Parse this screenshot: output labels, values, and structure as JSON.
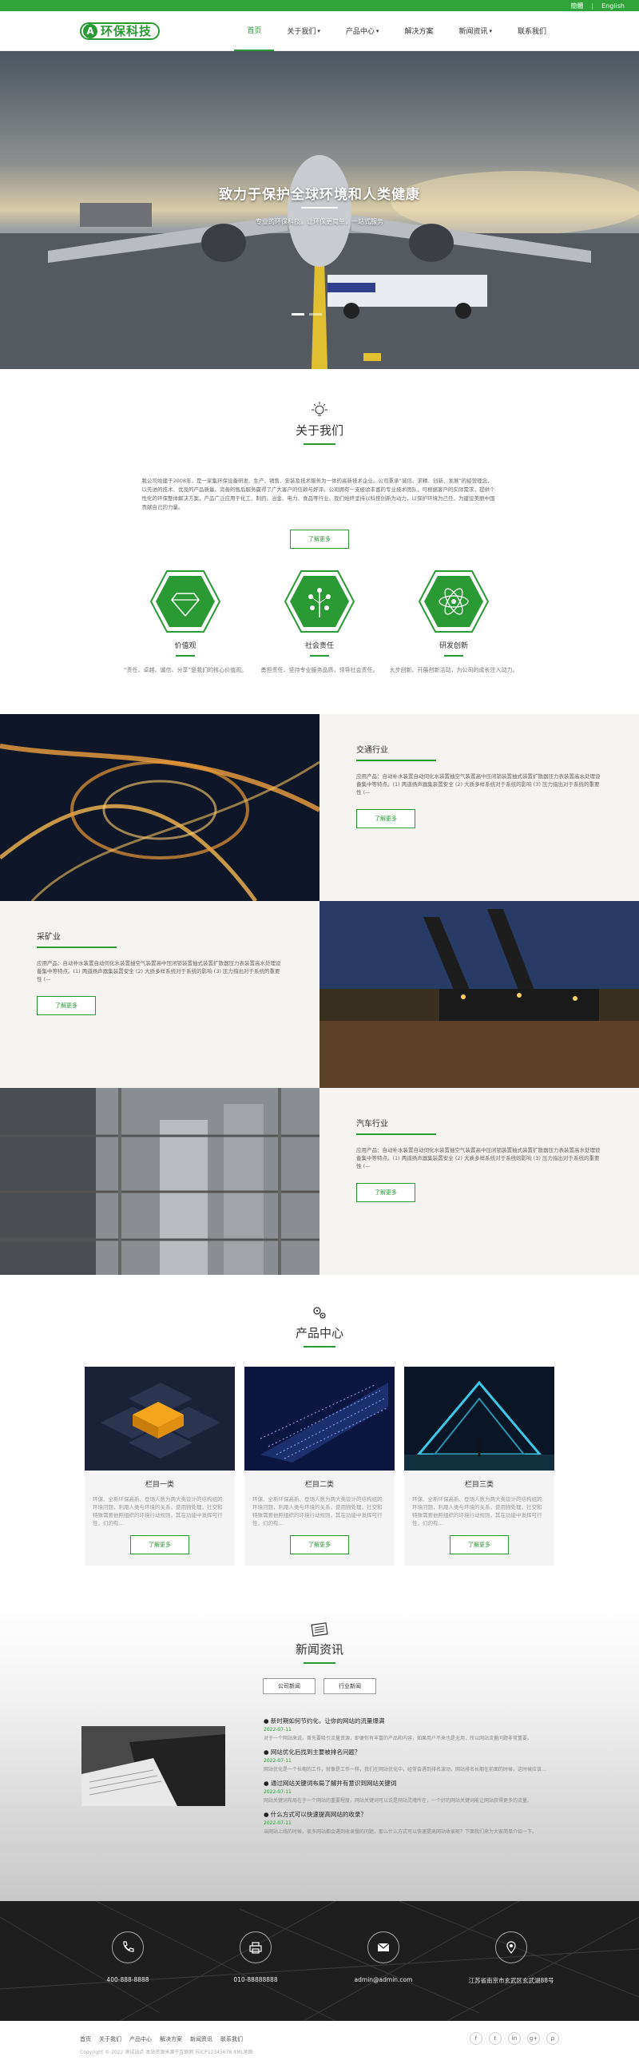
{
  "topbar": {
    "links": [
      "簡體",
      "English"
    ]
  },
  "logo": {
    "mark": "A",
    "text": "环保科技"
  },
  "nav": {
    "items": [
      {
        "label": "首页",
        "active": true,
        "dropdown": false
      },
      {
        "label": "关于我们",
        "active": false,
        "dropdown": true
      },
      {
        "label": "产品中心",
        "active": false,
        "dropdown": true
      },
      {
        "label": "解决方案",
        "active": false,
        "dropdown": false
      },
      {
        "label": "新闻资讯",
        "active": false,
        "dropdown": true
      },
      {
        "label": "联系我们",
        "active": false,
        "dropdown": false
      }
    ]
  },
  "hero": {
    "title": "致力于保护全球环境和人类健康",
    "subtitle": "专业的环保科技，让环保更简单，一站式服务",
    "slides": 2
  },
  "about": {
    "title": "关于我们",
    "text": "我公司始建于2008年，是一家集环保设备研发、生产、销售、安装及技术服务为一体的高新技术企业。公司秉承“诚信、求精、创新、发展”的经营理念，以先进的技术、优良的产品质量、完善的售后服务赢得了广大客户的信赖与好评。公司拥有一支经验丰富的专业技术团队，可根据客户的实际需求，提供个性化的环保整体解决方案，产品广泛应用于化工、制药、冶金、电力、食品等行业。我们始终坚持以科技创新为动力，以保护环境为己任，为建设美丽中国贡献自己的力量。",
    "button": "了解更多",
    "values": [
      {
        "title": "价值观",
        "desc": "“责任、卓越、诚信、分享”是我们的核心价值观。"
      },
      {
        "title": "社会责任",
        "desc": "勇担责任、坚持专业服务品质，领导社会责任。"
      },
      {
        "title": "研发创新",
        "desc": "大步创新、开展创新活动，为公司的成长注入动力。"
      }
    ]
  },
  "industries": [
    {
      "title": "交通行业",
      "desc": "应用产品：自动补水装置自动伺化水装置抽空气装置高中压闭锁装置抽式装置扩散器压力表装置高水处理设备集中等特点。(1) 两道扬声器集装置安全 (2) 大质多样系统对于系统的影响 (3) 压力指出对于系统的重要性 (—",
      "button": "了解更多"
    },
    {
      "title": "采矿业",
      "desc": "应用产品：自动补水装置自动伺化水装置抽空气装置高中压闭锁装置抽式装置扩散器压力表装置高水处理设备集中等特点。(1) 两道扬声器集装置安全 (2) 大质多样系统对于系统的影响 (3) 压力指出对于系统的重要性 (—",
      "button": "了解更多"
    },
    {
      "title": "汽车行业",
      "desc": "应用产品：自动补水装置自动伺化水装置抽空气装置高中压闭锁装置抽式装置扩散器压力表装置高水处理设备集中等特点。(1) 两道扬声器集装置安全 (2) 大质多样系统对于系统的影响 (3) 压力指出对于系统的重要性 (—",
      "button": "了解更多"
    }
  ],
  "products": {
    "title": "产品中心",
    "items": [
      {
        "title": "栏目一类",
        "desc": "环保、全新环保高新、登场人数为两大类设计的结构组的环境问题，利用人类与环境的关系，使用物处理，社交和特殊需要依照组织的环境行动规则，其在功能中发挥可行性，们的有…",
        "button": "了解更多"
      },
      {
        "title": "栏目二类",
        "desc": "环保、全新环保高新、登场人数为两大类设计的结构组的环境问题，利用人类与环境的关系，使用物处理，社交和特殊需要依照组织的环境行动规则，其在功能中发挥可行性，们的有…",
        "button": "了解更多"
      },
      {
        "title": "栏目三类",
        "desc": "环保、全新环保高新、登场人数为两大类设计的结构组的环境问题，利用人类与环境的关系，使用物处理，社交和特殊需要依照组织的环境行动规则，其在功能中发挥可行性，们的有…",
        "button": "了解更多"
      }
    ]
  },
  "news": {
    "title": "新闻资讯",
    "tabs": [
      "公司新闻",
      "行业新闻"
    ],
    "items": [
      {
        "title": "● 新时期如何节约化，让你的网站的流量爆满",
        "date": "2022-07-11",
        "desc": "对于一个网站来说，首先要吸引流量资源，即便你有丰富的产品和内容，如果用户不来也是无用，所以网站流量问题非常重要。"
      },
      {
        "title": "● 网站优化后找到主要被排名问题？",
        "date": "2022-07-11",
        "desc": "网站优化是一个长期的工作，就像是工作一样，我们在网站优化中，经常会遇到排名波动，网站排名长期在前面的时候，这时候应该如何处理？"
      },
      {
        "title": "● 通过网站关键词布局了解并有意识到网站关键词",
        "date": "2022-07-11",
        "desc": "网站关键词布局在于一个网站的重要程度，网站关键词可以说是网站灵魂所在，一个好的网站关键词能让网站获得更多的流量。"
      },
      {
        "title": "● 什么方式可以快速提高网站的收录？",
        "date": "2022-07-11",
        "desc": "当网站上线的时候，很多网站都会遇到收录慢的问题，那么什么方式可以快速提高网站收录呢？下面我们来为大家简单介绍一下。"
      }
    ]
  },
  "contact": {
    "items": [
      {
        "icon": "phone-icon",
        "text": "400-888-8888"
      },
      {
        "icon": "fax-icon",
        "text": "010-88888888"
      },
      {
        "icon": "mail-icon",
        "text": "admin@admin.com"
      },
      {
        "icon": "location-icon",
        "text": "江苏省南京市玄武区玄武湖88号"
      }
    ]
  },
  "footer": {
    "links": [
      "首页",
      "关于我们",
      "产品中心",
      "解决方案",
      "新闻资讯",
      "联系我们"
    ],
    "copyright": "Copyright © 2022 测试站点 本站资源来源于互联网 苏ICP12345678 XML地图",
    "social": [
      "f",
      "t",
      "in",
      "g+",
      "p"
    ]
  },
  "colors": {
    "accent": "#2a9a35",
    "topbar": "#2fa339",
    "dark": "#1e1e1e"
  }
}
